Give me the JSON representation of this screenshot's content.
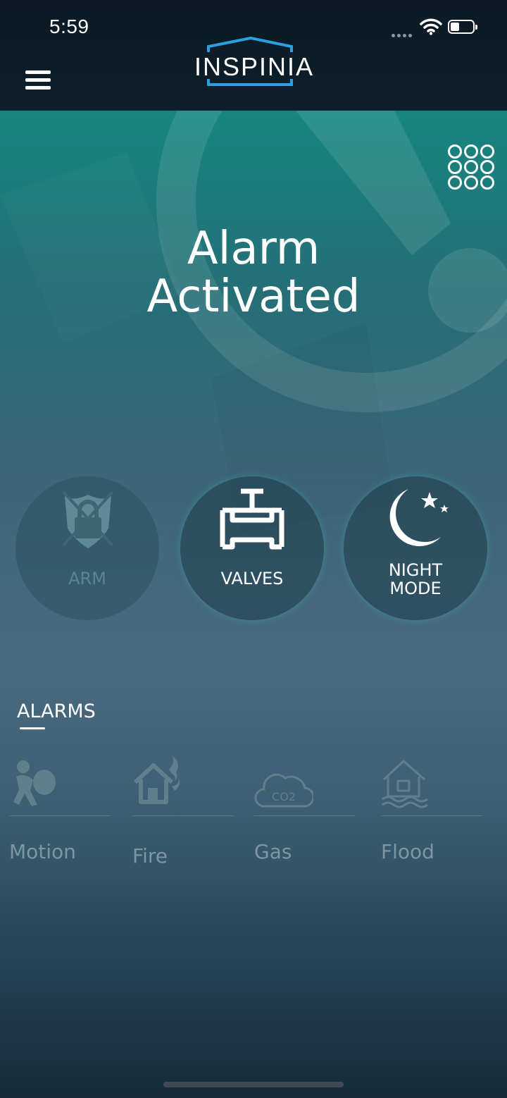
{
  "status_bar": {
    "time": "5:59"
  },
  "header": {
    "logo_text": "INSPINIA"
  },
  "hero": {
    "line1": "Alarm",
    "line2": "Activated"
  },
  "actions": {
    "arm": {
      "label": "ARM",
      "icon": "shield-lock-icon",
      "enabled": false
    },
    "valves": {
      "label": "VALVES",
      "icon": "valve-icon"
    },
    "night_mode": {
      "label_line1": "NIGHT",
      "label_line2": "MODE",
      "icon": "moon-stars-icon"
    }
  },
  "alarms": {
    "title": "ALARMS",
    "items": [
      {
        "label": "Motion",
        "icon": "burglar-icon"
      },
      {
        "label": "Fire",
        "icon": "house-fire-icon"
      },
      {
        "label": "Gas",
        "icon": "co2-cloud-icon"
      },
      {
        "label": "Flood",
        "icon": "house-flood-icon"
      }
    ]
  },
  "colors": {
    "accent": "#079d86",
    "header_bg": "#0b1a25",
    "logo_blue": "#2b9fe0"
  }
}
